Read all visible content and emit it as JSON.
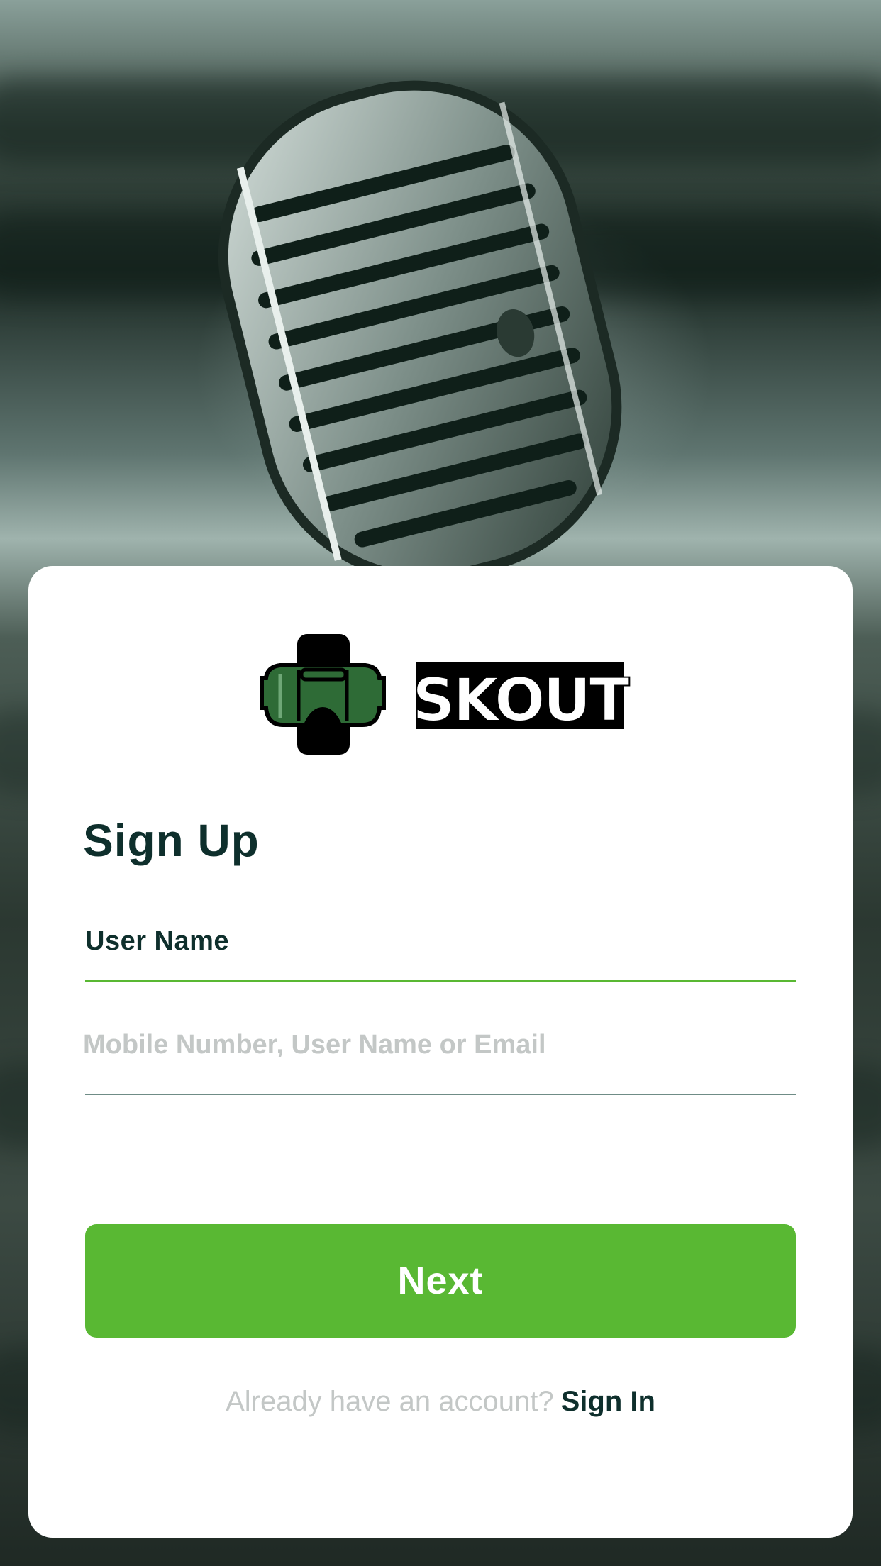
{
  "brand": {
    "name": "SKOUT",
    "accent": "#59b833",
    "dark": "#0e2f2c",
    "logo_green": "#2e6b36"
  },
  "form": {
    "title": "Sign Up",
    "username_label": "User Name",
    "username_placeholder": "Mobile Number, User Name or Email",
    "username_value": ""
  },
  "actions": {
    "next_label": "Next"
  },
  "footer": {
    "prompt": "Already have an account?",
    "signin_label": "Sign In"
  },
  "icons": {
    "logo": "vr-headset-icon",
    "background": "microphone-photo"
  }
}
